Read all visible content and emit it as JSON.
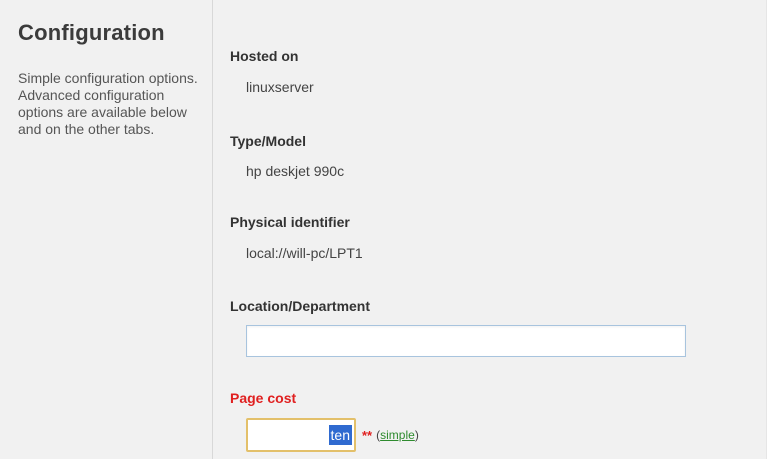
{
  "sidebar": {
    "title": "Configuration",
    "description": "Simple configuration options. Advanced configuration options are available below and on the other tabs."
  },
  "fields": {
    "hosted_on": {
      "label": "Hosted on",
      "value": "linuxserver"
    },
    "type_model": {
      "label": "Type/Model",
      "value": "hp deskjet 990c"
    },
    "physical_identifier": {
      "label": "Physical identifier",
      "value": "local://will-pc/LPT1"
    },
    "location": {
      "label": "Location/Department",
      "value": "",
      "placeholder": ""
    },
    "page_cost": {
      "label": "Page cost",
      "value": "ten",
      "required_marker": "**",
      "paren_open": "(",
      "link_label": "simple",
      "paren_close": ")",
      "label_color": "#e02020"
    }
  }
}
